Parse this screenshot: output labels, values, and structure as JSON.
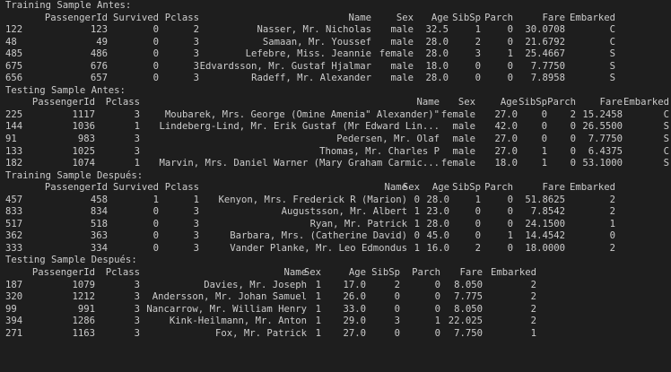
{
  "blocks": [
    {
      "title": "Training Sample Antes:",
      "columns": [
        "PassengerId",
        "Survived",
        "Pclass",
        "Name",
        "Sex",
        "Age",
        "SibSp",
        "Parch",
        "Fare",
        "Embarked"
      ],
      "rows": [
        [
          "122",
          "123",
          "0",
          "2",
          "Nasser, Mr. Nicholas",
          "male",
          "32.5",
          "1",
          "0",
          "30.0708",
          "C"
        ],
        [
          "48",
          "49",
          "0",
          "3",
          "Samaan, Mr. Youssef",
          "male",
          "28.0",
          "2",
          "0",
          "21.6792",
          "C"
        ],
        [
          "485",
          "486",
          "0",
          "3",
          "Lefebre, Miss. Jeannie",
          "female",
          "28.0",
          "3",
          "1",
          "25.4667",
          "S"
        ],
        [
          "675",
          "676",
          "0",
          "3",
          "Edvardsson, Mr. Gustaf Hjalmar",
          "male",
          "18.0",
          "0",
          "0",
          "7.7750",
          "S"
        ],
        [
          "656",
          "657",
          "0",
          "3",
          "Radeff, Mr. Alexander",
          "male",
          "28.0",
          "0",
          "0",
          "7.8958",
          "S"
        ]
      ]
    },
    {
      "title": "Testing Sample Antes:",
      "columns": [
        "PassengerId",
        "Pclass",
        "Name",
        "Sex",
        "Age",
        "SibSp",
        "Parch",
        "Fare",
        "Embarked"
      ],
      "rows": [
        [
          "225",
          "1117",
          "3",
          "Moubarek, Mrs. George (Omine Amenia\" Alexander)\"",
          "female",
          "27.0",
          "0",
          "2",
          "15.2458",
          "C"
        ],
        [
          "144",
          "1036",
          "1",
          "Lindeberg-Lind, Mr. Erik Gustaf (Mr Edward Lin...",
          "male",
          "42.0",
          "0",
          "0",
          "26.5500",
          "S"
        ],
        [
          "91",
          "983",
          "3",
          "Pedersen, Mr. Olaf",
          "male",
          "27.0",
          "0",
          "0",
          "7.7750",
          "S"
        ],
        [
          "133",
          "1025",
          "3",
          "Thomas, Mr. Charles P",
          "male",
          "27.0",
          "1",
          "0",
          "6.4375",
          "C"
        ],
        [
          "182",
          "1074",
          "1",
          "Marvin, Mrs. Daniel Warner (Mary Graham Carmic...",
          "female",
          "18.0",
          "1",
          "0",
          "53.1000",
          "S"
        ]
      ]
    },
    {
      "title": "Training Sample Después:",
      "columns": [
        "PassengerId",
        "Survived",
        "Pclass",
        "Name",
        "Sex",
        "Age",
        "SibSp",
        "Parch",
        "Fare",
        "Embarked"
      ],
      "rows": [
        [
          "457",
          "458",
          "1",
          "1",
          "Kenyon, Mrs. Frederick R (Marion)",
          "0",
          "28.0",
          "1",
          "0",
          "51.8625",
          "2"
        ],
        [
          "833",
          "834",
          "0",
          "3",
          "Augustsson, Mr. Albert",
          "1",
          "23.0",
          "0",
          "0",
          "7.8542",
          "2"
        ],
        [
          "517",
          "518",
          "0",
          "3",
          "Ryan, Mr. Patrick",
          "1",
          "28.0",
          "0",
          "0",
          "24.1500",
          "1"
        ],
        [
          "362",
          "363",
          "0",
          "3",
          "Barbara, Mrs. (Catherine David)",
          "0",
          "45.0",
          "0",
          "1",
          "14.4542",
          "0"
        ],
        [
          "333",
          "334",
          "0",
          "3",
          "Vander Planke, Mr. Leo Edmondus",
          "1",
          "16.0",
          "2",
          "0",
          "18.0000",
          "2"
        ]
      ]
    },
    {
      "title": "Testing Sample Después:",
      "columns": [
        "PassengerId",
        "Pclass",
        "Name",
        "Sex",
        "Age",
        "SibSp",
        "Parch",
        "Fare",
        "Embarked"
      ],
      "rows": [
        [
          "187",
          "1079",
          "3",
          "Davies, Mr. Joseph",
          "1",
          "17.0",
          "2",
          "0",
          "8.050",
          "2"
        ],
        [
          "320",
          "1212",
          "3",
          "Andersson, Mr. Johan Samuel",
          "1",
          "26.0",
          "0",
          "0",
          "7.775",
          "2"
        ],
        [
          "99",
          "991",
          "3",
          "Nancarrow, Mr. William Henry",
          "1",
          "33.0",
          "0",
          "0",
          "8.050",
          "2"
        ],
        [
          "394",
          "1286",
          "3",
          "Kink-Heilmann, Mr. Anton",
          "1",
          "29.0",
          "3",
          "1",
          "22.025",
          "2"
        ],
        [
          "271",
          "1163",
          "3",
          "Fox, Mr. Patrick",
          "1",
          "27.0",
          "0",
          "0",
          "7.750",
          "1"
        ]
      ]
    }
  ]
}
